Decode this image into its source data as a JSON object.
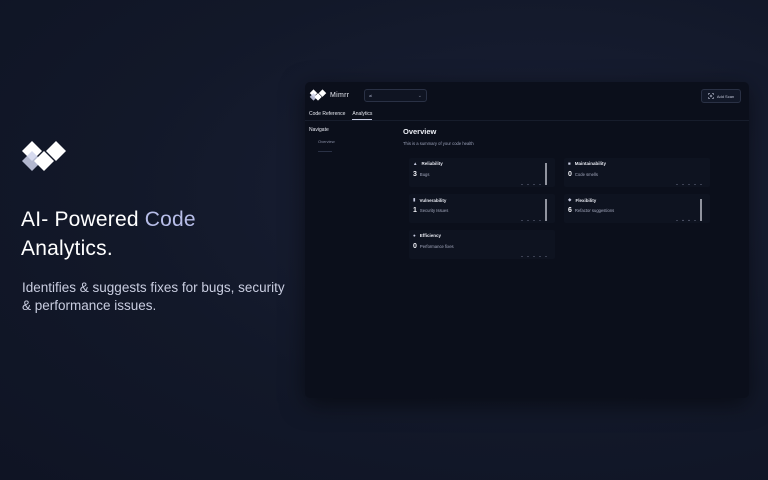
{
  "hero": {
    "title_main": "AI- Powered ",
    "title_accent": "Code",
    "title_end": "Analytics.",
    "description": "Identifies & suggests fixes for bugs, security & performance issues."
  },
  "app": {
    "brand_name": "Mimrr",
    "repo_selected": "ai",
    "add_button_label": "Add Scan",
    "tabs": [
      {
        "label": "Code Reference",
        "active": false
      },
      {
        "label": "Analytics",
        "active": true
      }
    ],
    "navigate_title": "Navigate",
    "nav_items": [
      "Overview"
    ],
    "overview_title": "Overview",
    "overview_subtitle": "This is a summary of your code health"
  },
  "cards": [
    {
      "title": "Reliability",
      "icon": "bug-icon",
      "value": "3",
      "label": "Bugs",
      "spark": [
        0,
        0,
        0,
        0,
        1
      ]
    },
    {
      "title": "Maintainability",
      "icon": "wrench-icon",
      "value": "0",
      "label": "Code smells",
      "spark": [
        0,
        0,
        0,
        0,
        0
      ]
    },
    {
      "title": "Vulnerability",
      "icon": "lock-icon",
      "value": "1",
      "label": "Security Issues",
      "spark": [
        0,
        0,
        0,
        0,
        1
      ]
    },
    {
      "title": "Flexibility",
      "icon": "puzzle-icon",
      "value": "6",
      "label": "Refactor suggestions",
      "spark": [
        0,
        0.05,
        0.05,
        0,
        1
      ]
    },
    {
      "title": "Efficiency",
      "icon": "gauge-icon",
      "value": "0",
      "label": "Performance fixes",
      "spark": [
        0,
        0,
        0,
        0,
        0
      ]
    }
  ]
}
